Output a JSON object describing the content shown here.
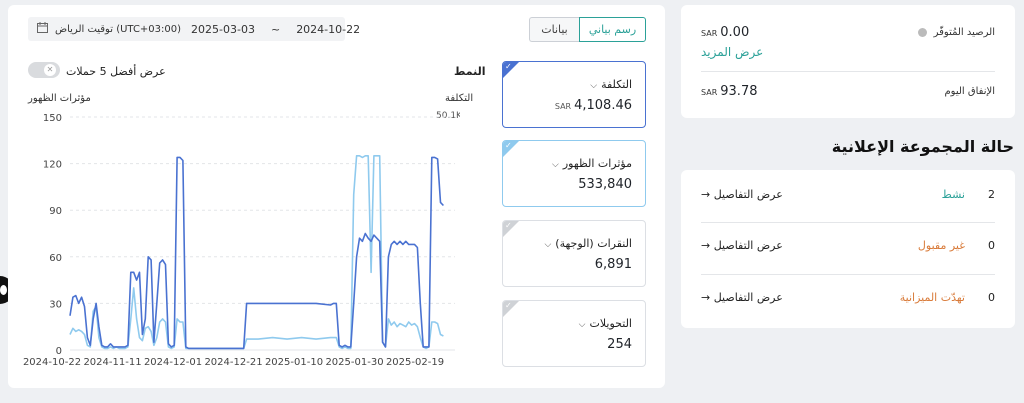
{
  "filters": {
    "timezone": "توقيت الرياض (UTC+03:00)",
    "date_start": "2024-10-22",
    "date_end": "2025-03-03",
    "separator": "~"
  },
  "view_toggle": {
    "chart_label": "رسم بياني",
    "data_label": "بيانات"
  },
  "chart_header": {
    "pattern_label": "النمط",
    "top5_label": "عرض أفضل 5 حملات",
    "left_axis_label": "مؤثرات الظهور",
    "right_axis_label": "التكلفة",
    "right_axis_top": "50.1K"
  },
  "metrics": [
    {
      "label": "التكلفة",
      "currency": "SAR",
      "value": "4,108.46",
      "color": "#4a72d1"
    },
    {
      "label": "مؤثرات الظهور",
      "currency": "",
      "value": "533,840",
      "color": "#8fcaee"
    },
    {
      "label": "النقرات (الوجهة)",
      "currency": "",
      "value": "6,891",
      "color": "#cfd2d6"
    },
    {
      "label": "التحويلات",
      "currency": "",
      "value": "254",
      "color": "#cfd2d6"
    }
  ],
  "balance": {
    "available_label": "الرصيد المُتوفّر",
    "available_value": "0.00",
    "currency": "SAR",
    "show_more": "عرض المزيد",
    "today_label": "الإنفاق اليوم",
    "today_value": "93.78"
  },
  "status_section": {
    "title": "حالة المجموعة الإعلانية",
    "rows": [
      {
        "count": "2",
        "name": "نشط",
        "details": "عرض التفاصيل",
        "arrow": "→"
      },
      {
        "count": "0",
        "name": "غير مقبول",
        "details": "عرض التفاصيل",
        "arrow": "→"
      },
      {
        "count": "0",
        "name": "تهدّت الميزانية",
        "details": "عرض التفاصيل",
        "arrow": "→"
      }
    ]
  },
  "chart_data": {
    "type": "line",
    "y_ticks": [
      0,
      30,
      60,
      90,
      120,
      150
    ],
    "ylim": [
      0,
      150
    ],
    "x_ticks": [
      "2024-10-22",
      "2024-11-11",
      "2024-12-01",
      "2024-12-21",
      "2025-01-10",
      "2025-01-30",
      "2025-02-19"
    ],
    "xlim_days": [
      0,
      133
    ],
    "series": [
      {
        "color": "#4a72d1",
        "points": [
          [
            0,
            22
          ],
          [
            1,
            34
          ],
          [
            2,
            35
          ],
          [
            3,
            30
          ],
          [
            4,
            34
          ],
          [
            5,
            28
          ],
          [
            6,
            8
          ],
          [
            7,
            3
          ],
          [
            8,
            20
          ],
          [
            9,
            30
          ],
          [
            10,
            15
          ],
          [
            11,
            3
          ],
          [
            12,
            2
          ],
          [
            13,
            2
          ],
          [
            14,
            4
          ],
          [
            15,
            2
          ],
          [
            16,
            2
          ],
          [
            17,
            2
          ],
          [
            18,
            2
          ],
          [
            19,
            2
          ],
          [
            20,
            3
          ],
          [
            21,
            50
          ],
          [
            22,
            50
          ],
          [
            23,
            45
          ],
          [
            24,
            50
          ],
          [
            25,
            10
          ],
          [
            26,
            20
          ],
          [
            27,
            60
          ],
          [
            28,
            58
          ],
          [
            29,
            5
          ],
          [
            30,
            30
          ],
          [
            31,
            56
          ],
          [
            32,
            58
          ],
          [
            33,
            55
          ],
          [
            34,
            4
          ],
          [
            35,
            2
          ],
          [
            36,
            3
          ],
          [
            37,
            124
          ],
          [
            38,
            124
          ],
          [
            39,
            122
          ],
          [
            40,
            2
          ],
          [
            41,
            1
          ],
          [
            42,
            1
          ],
          [
            44,
            1
          ],
          [
            46,
            1
          ],
          [
            50,
            1
          ],
          [
            55,
            1
          ],
          [
            60,
            1
          ],
          [
            61,
            30
          ],
          [
            62,
            30
          ],
          [
            65,
            30
          ],
          [
            70,
            30
          ],
          [
            75,
            30
          ],
          [
            80,
            30
          ],
          [
            85,
            30
          ],
          [
            90,
            29
          ],
          [
            91,
            30
          ],
          [
            92,
            30
          ],
          [
            93,
            3
          ],
          [
            94,
            2
          ],
          [
            95,
            3
          ],
          [
            96,
            2
          ],
          [
            97,
            2
          ],
          [
            98,
            30
          ],
          [
            99,
            60
          ],
          [
            100,
            72
          ],
          [
            101,
            70
          ],
          [
            102,
            75
          ],
          [
            103,
            72
          ],
          [
            104,
            70
          ],
          [
            105,
            74
          ],
          [
            106,
            72
          ],
          [
            107,
            70
          ],
          [
            108,
            5
          ],
          [
            109,
            2
          ],
          [
            110,
            60
          ],
          [
            111,
            68
          ],
          [
            112,
            70
          ],
          [
            113,
            68
          ],
          [
            114,
            70
          ],
          [
            115,
            68
          ],
          [
            116,
            70
          ],
          [
            117,
            68
          ],
          [
            118,
            68
          ],
          [
            119,
            68
          ],
          [
            120,
            66
          ],
          [
            121,
            30
          ],
          [
            122,
            2
          ],
          [
            123,
            2
          ],
          [
            124,
            2
          ],
          [
            125,
            124
          ],
          [
            126,
            124
          ],
          [
            127,
            123
          ],
          [
            128,
            95
          ],
          [
            129,
            93
          ]
        ]
      },
      {
        "color": "#8fcaee",
        "points": [
          [
            0,
            10
          ],
          [
            1,
            14
          ],
          [
            2,
            12
          ],
          [
            3,
            13
          ],
          [
            4,
            12
          ],
          [
            5,
            10
          ],
          [
            6,
            3
          ],
          [
            7,
            2
          ],
          [
            8,
            25
          ],
          [
            9,
            28
          ],
          [
            10,
            8
          ],
          [
            11,
            2
          ],
          [
            12,
            1
          ],
          [
            13,
            1
          ],
          [
            14,
            2
          ],
          [
            15,
            1
          ],
          [
            16,
            2
          ],
          [
            17,
            1
          ],
          [
            18,
            1
          ],
          [
            19,
            1
          ],
          [
            20,
            2
          ],
          [
            21,
            20
          ],
          [
            22,
            40
          ],
          [
            23,
            20
          ],
          [
            24,
            8
          ],
          [
            25,
            6
          ],
          [
            26,
            14
          ],
          [
            27,
            15
          ],
          [
            28,
            12
          ],
          [
            29,
            3
          ],
          [
            30,
            8
          ],
          [
            31,
            18
          ],
          [
            32,
            20
          ],
          [
            33,
            18
          ],
          [
            34,
            2
          ],
          [
            35,
            1
          ],
          [
            36,
            2
          ],
          [
            37,
            20
          ],
          [
            38,
            18
          ],
          [
            39,
            18
          ],
          [
            40,
            1
          ],
          [
            41,
            1
          ],
          [
            42,
            1
          ],
          [
            44,
            1
          ],
          [
            46,
            1
          ],
          [
            50,
            1
          ],
          [
            55,
            1
          ],
          [
            60,
            1
          ],
          [
            61,
            7
          ],
          [
            62,
            7
          ],
          [
            65,
            7
          ],
          [
            70,
            8
          ],
          [
            75,
            7
          ],
          [
            80,
            8
          ],
          [
            85,
            7
          ],
          [
            90,
            8
          ],
          [
            91,
            8
          ],
          [
            92,
            8
          ],
          [
            93,
            2
          ],
          [
            94,
            1
          ],
          [
            95,
            2
          ],
          [
            96,
            1
          ],
          [
            97,
            1
          ],
          [
            98,
            100
          ],
          [
            99,
            125
          ],
          [
            100,
            125
          ],
          [
            101,
            124
          ],
          [
            102,
            125
          ],
          [
            103,
            125
          ],
          [
            104,
            50
          ],
          [
            105,
            125
          ],
          [
            106,
            125
          ],
          [
            107,
            125
          ],
          [
            108,
            5
          ],
          [
            109,
            2
          ],
          [
            110,
            20
          ],
          [
            111,
            16
          ],
          [
            112,
            18
          ],
          [
            113,
            15
          ],
          [
            114,
            17
          ],
          [
            115,
            16
          ],
          [
            116,
            15
          ],
          [
            117,
            18
          ],
          [
            118,
            16
          ],
          [
            119,
            17
          ],
          [
            120,
            15
          ],
          [
            121,
            8
          ],
          [
            122,
            2
          ],
          [
            123,
            1
          ],
          [
            124,
            2
          ],
          [
            125,
            18
          ],
          [
            126,
            18
          ],
          [
            127,
            17
          ],
          [
            128,
            10
          ],
          [
            129,
            9
          ]
        ]
      }
    ]
  }
}
